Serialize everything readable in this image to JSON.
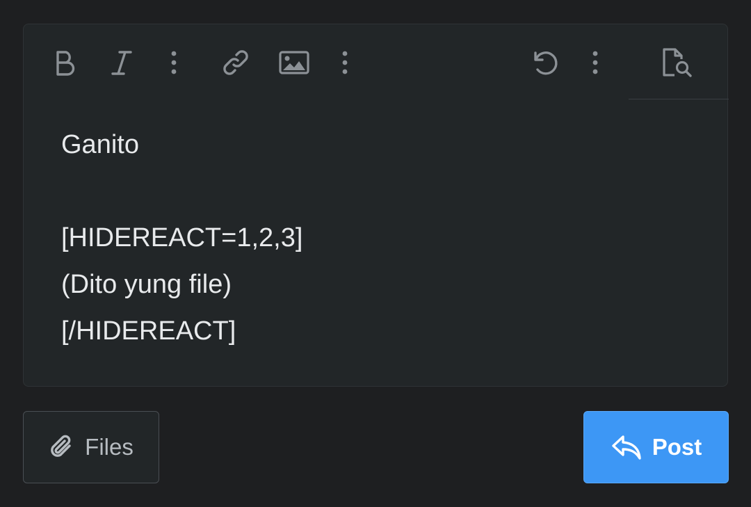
{
  "editor": {
    "toolbar": {
      "icons": [
        "bold-icon",
        "italic-icon",
        "more-vertical-icon",
        "link-icon",
        "image-icon",
        "more-vertical-icon",
        "undo-icon",
        "more-vertical-icon",
        "preview-icon"
      ]
    },
    "content_lines": [
      "Ganito",
      "",
      "[HIDEREACT=1,2,3]",
      "(Dito yung file)",
      "[/HIDEREACT]"
    ]
  },
  "actions": {
    "files_label": "Files",
    "post_label": "Post"
  },
  "colors": {
    "background": "#1e1f21",
    "editor_bg": "#222628",
    "accent": "#3d97f5",
    "icon": "#8c9196",
    "text": "#e8eaec"
  }
}
